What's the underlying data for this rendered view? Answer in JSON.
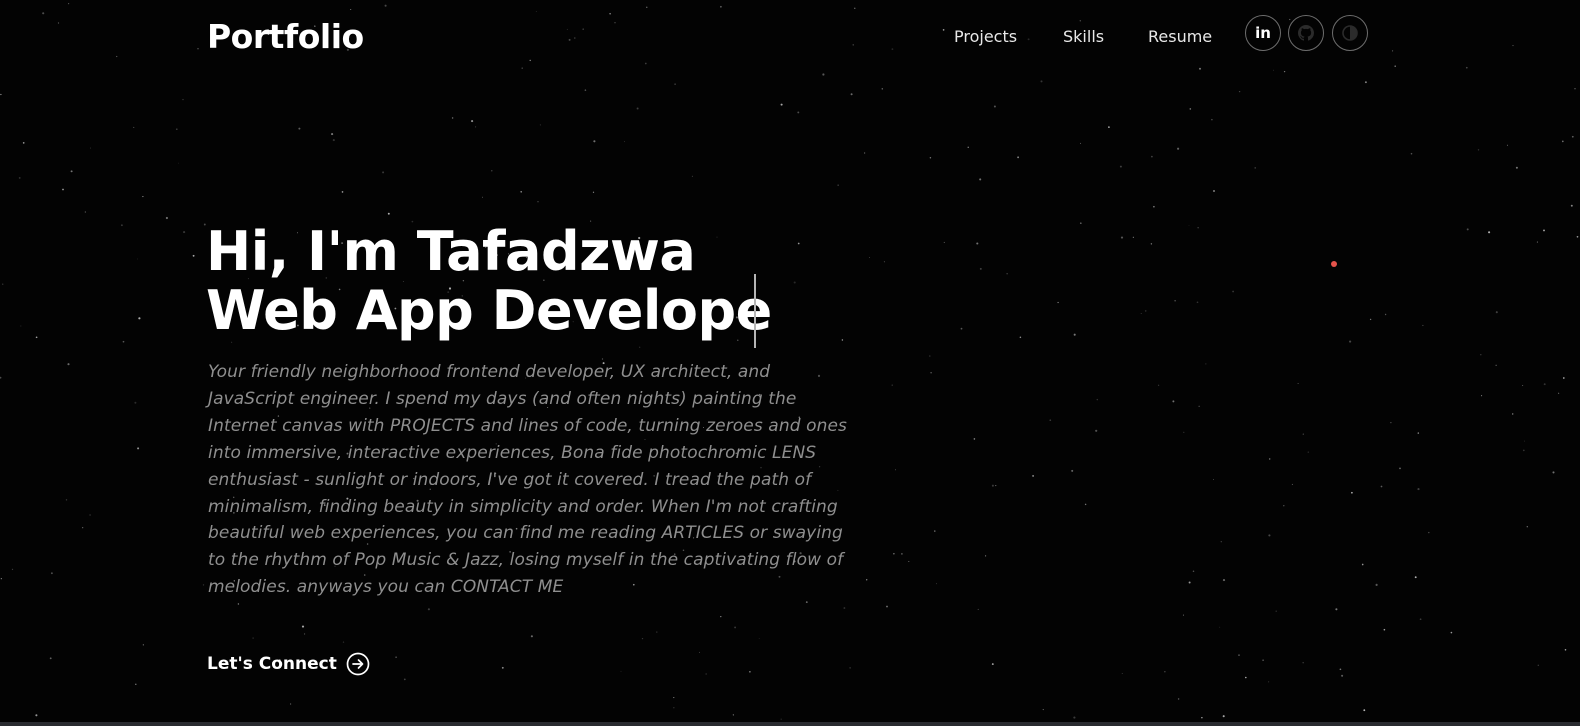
{
  "header": {
    "logo": "Portfolio",
    "nav": [
      {
        "label": "Projects"
      },
      {
        "label": "Skills"
      },
      {
        "label": "Resume"
      }
    ],
    "icons": [
      {
        "name": "linkedin-icon",
        "label": "in"
      },
      {
        "name": "github-icon"
      },
      {
        "name": "theme-toggle-icon"
      }
    ]
  },
  "hero": {
    "greeting": "Hi, I'm Tafadzwa",
    "typed_text": "Web App Develope",
    "bio": "Your friendly neighborhood frontend developer, UX architect, and JavaScript engineer. I spend my days (and often nights) painting the Internet canvas with PROJECTS and lines of code, turning zeroes and ones into immersive, interactive experiences, Bona fide photochromic LENS enthusiast - sunlight or indoors, I've got it covered. I tread the path of minimalism, finding beauty in simplicity and order. When I'm not crafting beautiful web experiences, you can find me reading ARTICLES or swaying to the rhythm of Pop Music & Jazz, losing myself in the captivating flow of melodies. anyways you can CONTACT ME",
    "cta_label": "Let's Connect"
  },
  "colors": {
    "background": "#030303",
    "text": "#ffffff",
    "bio_text": "#8f8f8f",
    "accent_dot": "#e5534b",
    "border": "#6d6d6d"
  }
}
